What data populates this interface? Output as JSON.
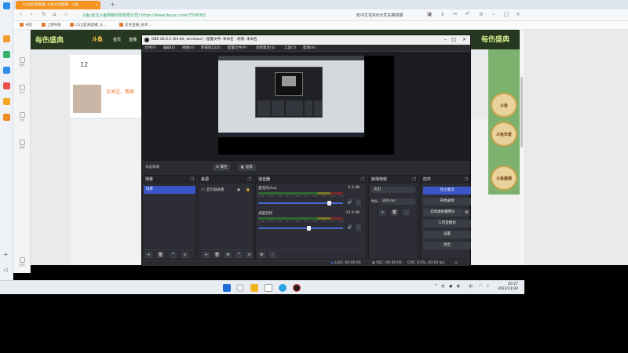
{
  "browser": {
    "tab_title": "CS立起来直播_斗鱼大战直播 - 斗鱼",
    "new_tab": "+",
    "url": "斗鱼(武汉斗鱼网络科技有限公司)  https://www.douyu.com/7506081",
    "search_hint": "轮中生花900元优先推高额",
    "bookmarks": [
      "书签",
      "上网导航",
      "CS立起来直播_斗...",
      "虎牙直播_技术..."
    ]
  },
  "douyu": {
    "logo_text": "每伤盛典",
    "logo2": "斗鱼",
    "nav": [
      "首页",
      "直播",
      "分类"
    ],
    "card_count": "12",
    "card_sub": "点关注，帮助",
    "logo_right": "每伤盛典",
    "left_items": [
      "推荐",
      "关注",
      "分类",
      "直播",
      "游戏"
    ],
    "badges": [
      "斗鱼",
      "斗鱼年度",
      "年度盛典",
      "斗鱼盛典"
    ]
  },
  "obs": {
    "title": "OBS 28.0.3 (64-bit, windows) - 配置文件: 未命名 - 场景: 未命名",
    "menu": [
      "文件(F)",
      "编辑(E)",
      "视图(V)",
      "停靠窗口(D)",
      "配置文件(P)",
      "场景集合(S)",
      "工具(T)",
      "帮助(H)"
    ],
    "source_bar_label": "未选择源",
    "properties_btn": "属性",
    "filters_btn": "滤镜",
    "docks": {
      "scenes": {
        "title": "场景",
        "items": [
          "场景"
        ]
      },
      "sources": {
        "title": "来源",
        "items": [
          "显示器采集"
        ]
      },
      "mixer": {
        "title": "混音器",
        "channels": [
          {
            "name": "麦克风/Aux",
            "db": "0.0 dB",
            "level": 0.85
          },
          {
            "name": "桌面音频",
            "db": "-12.0 dB",
            "level": 0.6
          }
        ],
        "ticks": "-60 -55 -50 -45 -40 -35 -30 -25 -20 -15 -10 -5 0"
      },
      "transitions": {
        "title": "转场特效",
        "type": "淡出",
        "duration_label": "时长",
        "duration": "300 ms"
      },
      "controls": {
        "title": "控件",
        "buttons": [
          "停止推流",
          "开始录制",
          "启动虚拟摄像头",
          "工作室模式",
          "设置",
          "退出"
        ]
      }
    },
    "status": {
      "live": "LIVE: 00:00:00",
      "rec": "REC: 00:00:00",
      "cpu": "CPU: 0.0%, 60.00 fps"
    }
  },
  "taskbar": {
    "tray_lang": "中",
    "time": "20:27",
    "date": "2022/11/28"
  }
}
